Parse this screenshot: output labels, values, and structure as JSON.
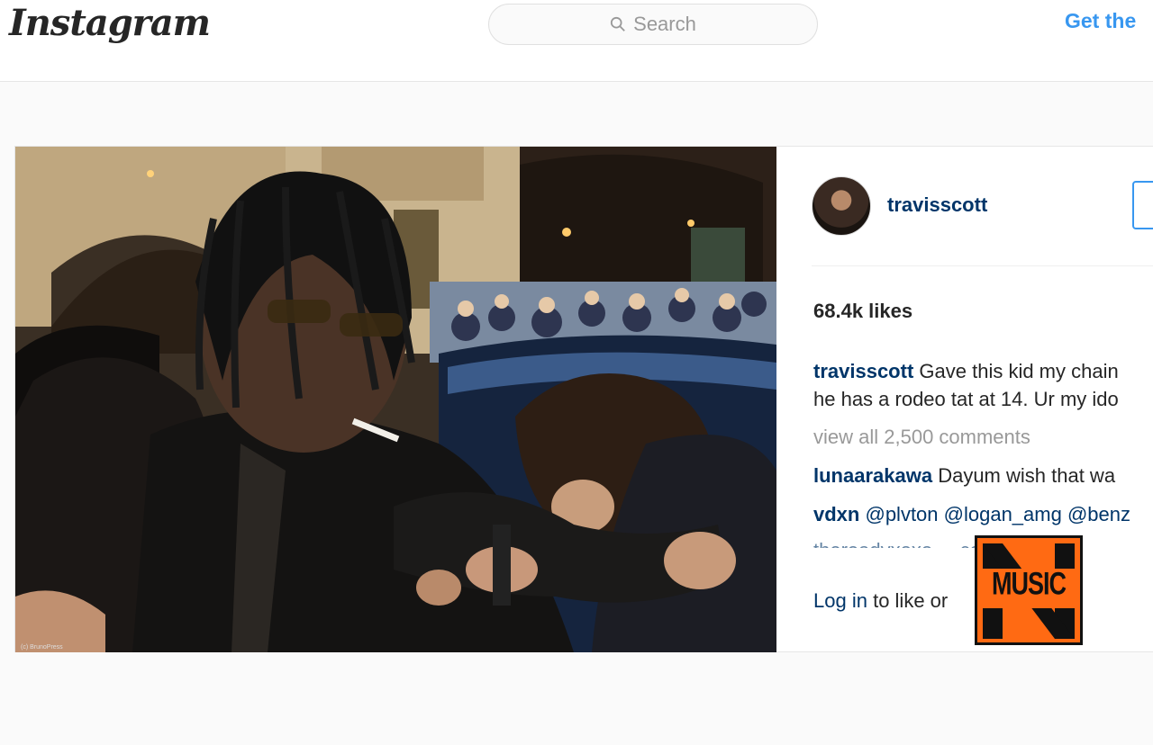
{
  "header": {
    "logo_text": "Instagram",
    "search_placeholder": "Search",
    "get_app_label": "Get the"
  },
  "photo": {
    "credit": "(c) BrunoPress"
  },
  "post": {
    "username": "travisscott",
    "likes": "68.4k likes",
    "caption_user": "travisscott",
    "caption_line1": "Gave this kid my chain",
    "caption_line2": "he has a rodeo tat at 14. Ur my ido",
    "view_all": "view all 2,500 comments",
    "comments": [
      {
        "user": "lunaarakawa",
        "text": "Dayum wish that wa"
      },
      {
        "user": "vdxn",
        "text": "@plvton @logan_amg @benz"
      }
    ],
    "faded_comment": "thereadyxoxo ... collbiet",
    "login_link": "Log in",
    "login_rest": "to like or"
  },
  "badge": {
    "label": "MUSIC",
    "letter": "N",
    "color": "#ff6a13"
  }
}
